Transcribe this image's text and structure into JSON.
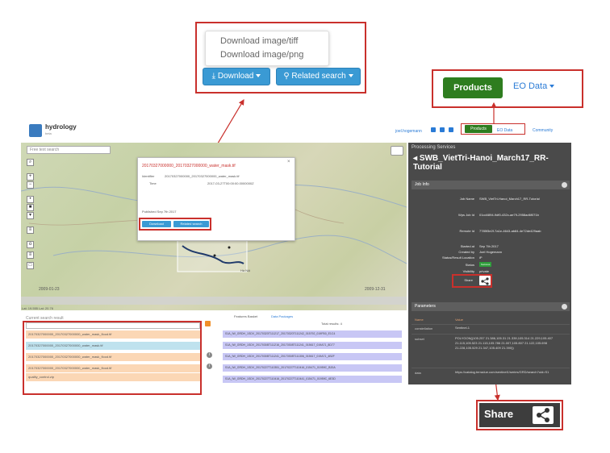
{
  "callout_download": {
    "menu_items": [
      "Download image/tiff",
      "Download image/png"
    ],
    "download_label": "Download",
    "related_label": "Related search"
  },
  "callout_products": {
    "products_label": "Products",
    "eo_label": "EO Data"
  },
  "header": {
    "app_name": "hydrology",
    "app_sub": "beta",
    "user": "joel.hogemann",
    "products_label": "Products",
    "eo_label": "EO Data",
    "community_label": "Community"
  },
  "map": {
    "search_placeholder": "Free text search",
    "date_left": "2009-01-23",
    "date_right": "2009-12-31",
    "latlon": "Lat: 19.555 Lat: 20.76",
    "popup": {
      "title": "20170327000000_20170327000000_water_mask.tif",
      "identifier_label": "Identifier",
      "identifier_value": "20170327000000_20170327000000_water_mask.tif",
      "time_label": "Time",
      "time_value": "2017-03-27T00:00:00.0000000Z",
      "published": "Published Sep 7th 2017",
      "download_label": "Download",
      "related_label": "Related search"
    },
    "map_labels": [
      "Hà Nội"
    ]
  },
  "right_panel": {
    "section": "Processing Services",
    "title": "SWB_VietTri-Hanoi_March17_RR-Tutorial",
    "job_info_label": "Job Info",
    "fields": [
      {
        "label": "Job Name",
        "value": "SWB_VietTri-Hanoi_March17_RR-Tutorial"
      },
      {
        "label": "Wps Job Id",
        "value": "01cd4894-9df0-432c-ae79-2958ad6f071b"
      },
      {
        "label": "Remote Id",
        "value": "7785f3e2f-7a1e-4643-ab84-4e72de429aab"
      },
      {
        "label": "Started at",
        "value": "Sep 7th 2017"
      },
      {
        "label": "Created by",
        "value": "Joel Hogemann"
      },
      {
        "label": "Status/Result Location",
        "value": "iP"
      },
      {
        "label": "Status",
        "value": "Success"
      },
      {
        "label": "Visibility",
        "value": "private"
      }
    ],
    "share_label": "Share",
    "parameters_label": "Parameters",
    "param_header": {
      "key": "Name",
      "value": "Value"
    },
    "params": [
      {
        "key": "constellation",
        "value": "Sentinel-1"
      },
      {
        "key": "subset",
        "value": "POLYGON((105.257 21.386,105.31 21.339,105.314 21.229,105.407 21.115,105.523 21.115,105.786 21.007,105.807 21.122,105.698 21.228,105.529 21.347,105.409 21.390))"
      },
      {
        "key": "data",
        "value": "https://catalog.terradue.com/sentinel1/series/GRD/search?uid=S1"
      }
    ]
  },
  "bottom": {
    "list_label": "Current search result",
    "rows": [
      "20170327000000_20170327000000_water_mask_flood.tif",
      "20170327000000_20170327000000_water_mask.tif",
      "20170327000000_20170327000000_water_mask_flood.tif",
      "20170327000000_20170327000000_water_mask_flood.tif",
      "quality_control.zip"
    ],
    "feature_tab": "Features Basket",
    "data_packages_tab": "Data Packages",
    "results_label": "Total results: 4",
    "feature_rows": [
      "S1A_IW_GRDH_1SDV_20170320T111217_20170320T111242_015792_019FB0_E1C4",
      "S1A_IW_GRDH_1SDV_20170308T111216_20170308T111241_015617_019A71_8D77",
      "S1A_IW_GRDH_1SDV_20170308T111241_20170308T111306_015617_019A71_4B2F",
      "S1A_IW_GRDH_1SDV_20170227T110351_20170227T110416_015471_01959C_B20A",
      "S1A_IW_GRDH_1SDV_20170227T110416_20170227T110441_015471_01959C_6E3D"
    ]
  },
  "share_callout": {
    "label": "Share"
  },
  "colors": {
    "highlight": "#c9302c",
    "products_green": "#2e7d1f",
    "download_blue": "#3a9ad4",
    "panel_dark": "#4a4a4a"
  }
}
